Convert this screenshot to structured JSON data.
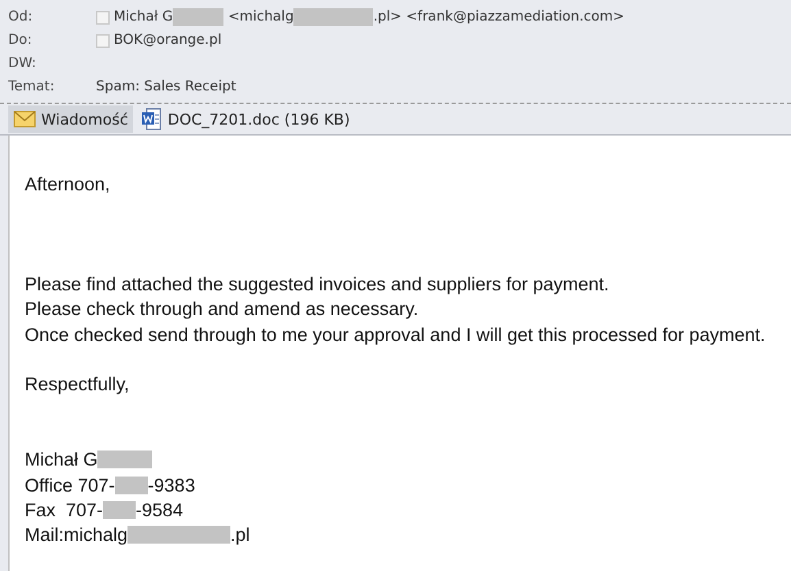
{
  "header": [
    {
      "label": "Od:",
      "checkbox": {
        "checked": false
      },
      "parts": [
        {
          "kind": "text",
          "text": "Michał G"
        },
        {
          "kind": "redacted"
        },
        {
          "kind": "text",
          "text": " <michalg"
        },
        {
          "kind": "redacted"
        },
        {
          "kind": "text",
          "text": ".pl> <frank@piazzamediation.com>"
        }
      ]
    },
    {
      "label": "Do:",
      "checkbox": {
        "checked": false
      },
      "parts": [
        {
          "kind": "text",
          "text": "BOK@orange.pl"
        }
      ]
    },
    {
      "label": "DW:"
    },
    {
      "label": "Temat:",
      "parts": [
        {
          "kind": "text",
          "text": "Spam: Sales Receipt"
        }
      ]
    }
  ],
  "tabs": [
    {
      "kind": "message",
      "label": "Wiadomość",
      "selected": true
    },
    {
      "kind": "word-doc",
      "label": "DOC_7201.doc (196 KB)",
      "selected": false
    }
  ],
  "body": [
    {
      "kind": "blank"
    },
    {
      "kind": "line",
      "parts": [
        {
          "kind": "text",
          "text": "Afternoon,"
        }
      ]
    },
    {
      "kind": "blank"
    },
    {
      "kind": "blank"
    },
    {
      "kind": "blank"
    },
    {
      "kind": "line",
      "parts": [
        {
          "kind": "text",
          "text": "Please find attached the suggested invoices and suppliers for payment."
        }
      ]
    },
    {
      "kind": "line",
      "parts": [
        {
          "kind": "text",
          "text": "Please check through and amend as necessary."
        }
      ]
    },
    {
      "kind": "line",
      "parts": [
        {
          "kind": "text",
          "text": "Once checked send through to me your approval and I will get this processed for payment."
        }
      ]
    },
    {
      "kind": "blank"
    },
    {
      "kind": "line",
      "parts": [
        {
          "kind": "text",
          "text": "Respectfully,"
        }
      ]
    },
    {
      "kind": "blank"
    },
    {
      "kind": "blank"
    },
    {
      "kind": "line",
      "parts": [
        {
          "kind": "text",
          "text": "Michał G"
        },
        {
          "kind": "redacted"
        }
      ]
    },
    {
      "kind": "line",
      "parts": [
        {
          "kind": "text",
          "text": "Office 707-"
        },
        {
          "kind": "redacted"
        },
        {
          "kind": "text",
          "text": "-9383"
        }
      ]
    },
    {
      "kind": "line",
      "parts": [
        {
          "kind": "text",
          "text": "Fax  707-"
        },
        {
          "kind": "redacted"
        },
        {
          "kind": "text",
          "text": "-9584"
        }
      ]
    },
    {
      "kind": "line",
      "parts": [
        {
          "kind": "text",
          "text": "Mail:michalg"
        },
        {
          "kind": "redacted"
        },
        {
          "kind": "text",
          "text": ".pl"
        }
      ]
    }
  ]
}
